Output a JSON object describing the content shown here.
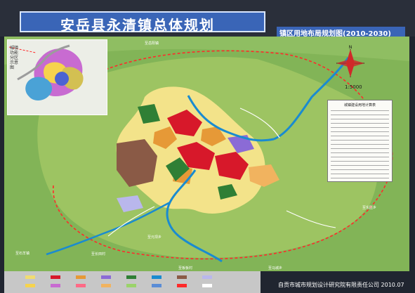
{
  "header": {
    "title": "安岳县永清镇总体规划",
    "subtitle": "镇区用地布局规划图(2010-2030)"
  },
  "inset": {
    "title": "城镇功能分区示意图"
  },
  "scale": "1:5000",
  "credit": "自贡市城市规划设计研究院有限责任公司 2010.07",
  "road_labels": [
    "至岳阳镇",
    "至东胜乡",
    "至元坝乡",
    "至长田村",
    "至石羊镇",
    "至板板村",
    "至马城乡"
  ],
  "stats_table": {
    "title": "城镇建设用地计算表"
  },
  "colors": {
    "title_bg": "#3a65b7",
    "map_base": "#7bb35a",
    "residential": "#f1dc72",
    "commercial": "#d7182a",
    "public": "#e69937",
    "green": "#2f7f35",
    "river": "#1a8bd0",
    "boundary": "#ff0000"
  }
}
